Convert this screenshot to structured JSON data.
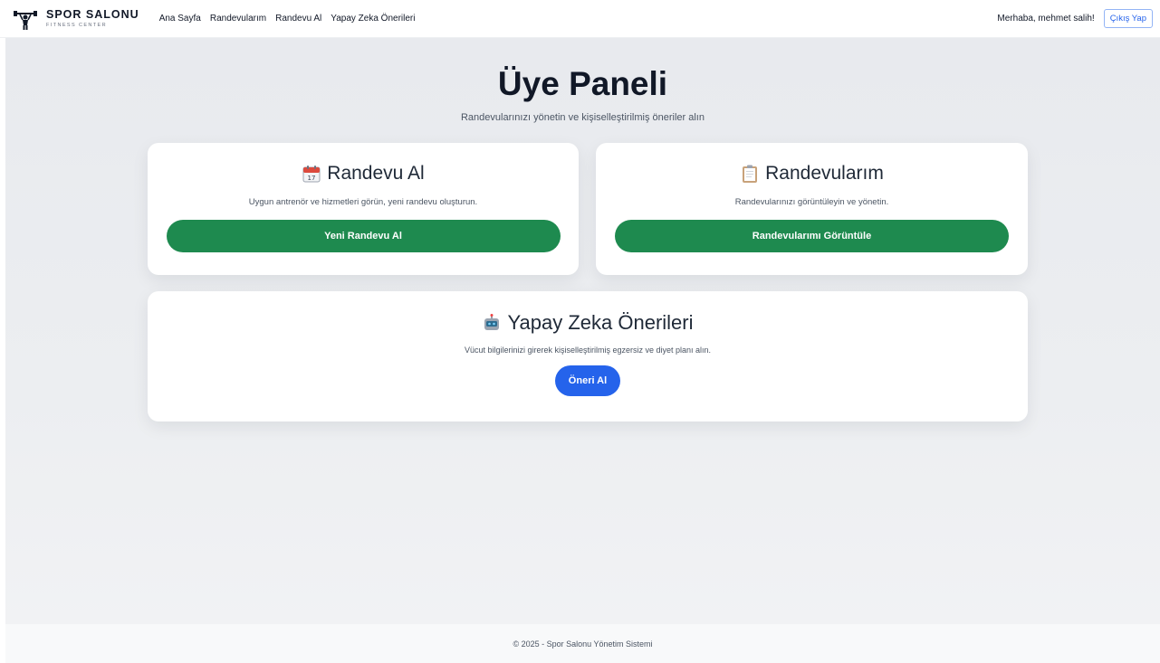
{
  "navbar": {
    "brand_name": "SPOR SALONU",
    "brand_sub": "FITNESS CENTER",
    "links": [
      "Ana Sayfa",
      "Randevularım",
      "Randevu Al",
      "Yapay Zeka Önerileri"
    ],
    "greeting": "Merhaba, mehmet salih!",
    "logout_label": "Çıkış Yap"
  },
  "main": {
    "title": "Üye Paneli",
    "subtitle": "Randevularınızı yönetin ve kişiselleştirilmiş öneriler alın"
  },
  "cards": {
    "appointment": {
      "title": "Randevu Al",
      "description": "Uygun antrenör ve hizmetleri görün, yeni randevu oluşturun.",
      "button": "Yeni Randevu Al"
    },
    "my_appointments": {
      "title": "Randevularım",
      "description": "Randevularınızı görüntüleyin ve yönetin.",
      "button": "Randevularımı Görüntüle"
    },
    "ai": {
      "title": "Yapay Zeka Önerileri",
      "description": "Vücut bilgilerinizi girerek kişiselleştirilmiş egzersiz ve diyet planı alın.",
      "button": "Öneri Al"
    }
  },
  "footer": {
    "text": "© 2025 - Spor Salonu Yönetim Sistemi"
  },
  "colors": {
    "green": "#1e8a4f",
    "blue": "#2563eb",
    "background": "#e8eaee"
  },
  "icons": {
    "brand": "dumbbell-lifter-icon",
    "appointment": "calendar-icon",
    "my_appointments": "clipboard-icon",
    "ai": "robot-icon"
  }
}
